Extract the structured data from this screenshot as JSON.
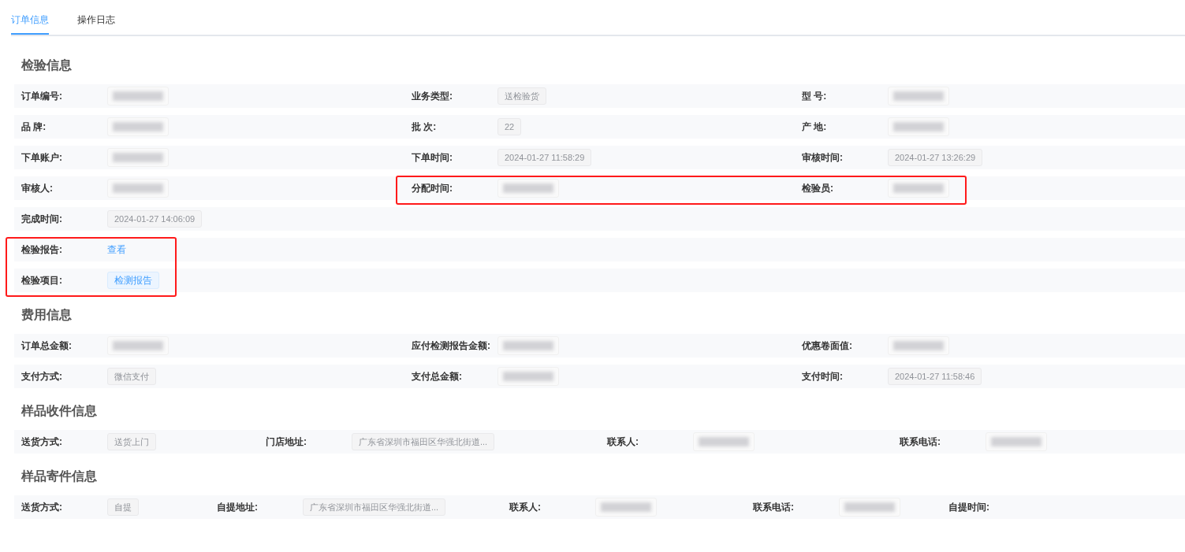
{
  "tabs": [
    {
      "label": "订单信息",
      "selected": true
    },
    {
      "label": "操作日志",
      "selected": false
    }
  ],
  "sections": [
    {
      "title": "检验信息",
      "rows": [
        {
          "fields": [
            {
              "label": "订单编号:",
              "kind": "blurred",
              "highlighted": false
            },
            {
              "label": "业务类型:",
              "kind": "tag",
              "value": "送检验货",
              "highlighted": false
            },
            {
              "label": "型 号:",
              "kind": "blurred",
              "highlighted": false
            }
          ]
        },
        {
          "fields": [
            {
              "label": "品 牌:",
              "kind": "blurred",
              "highlighted": false
            },
            {
              "label": "批 次:",
              "kind": "tag",
              "value": "22",
              "highlighted": false
            },
            {
              "label": "产 地:",
              "kind": "blurred",
              "highlighted": false
            }
          ]
        },
        {
          "fields": [
            {
              "label": "下单账户:",
              "kind": "blurred",
              "highlighted": false
            },
            {
              "label": "下单时间:",
              "kind": "tag",
              "value": "2024-01-27 11:58:29",
              "highlighted": false
            },
            {
              "label": "审核时间:",
              "kind": "tag",
              "value": "2024-01-27 13:26:29",
              "highlighted": false
            }
          ]
        },
        {
          "fields": [
            {
              "label": "审核人:",
              "kind": "blurred",
              "highlighted": false
            },
            {
              "label": "分配时间:",
              "kind": "blurred",
              "highlighted": true
            },
            {
              "label": "检验员:",
              "kind": "blurred",
              "highlighted": true
            }
          ]
        },
        {
          "fields": [
            {
              "label": "完成时间:",
              "kind": "tag",
              "value": "2024-01-27 14:06:09",
              "highlighted": false
            }
          ]
        },
        {
          "fields": [
            {
              "label": "检验报告:",
              "kind": "link",
              "value": "查看",
              "highlighted": true
            }
          ]
        },
        {
          "fields": [
            {
              "label": "检验项目:",
              "kind": "accent",
              "value": "检测报告",
              "highlighted": true
            }
          ]
        }
      ]
    },
    {
      "title": "费用信息",
      "rows": [
        {
          "fields": [
            {
              "label": "订单总金额:",
              "kind": "blurred",
              "highlighted": false
            },
            {
              "label": "应付检测报告金额:",
              "kind": "blurred",
              "highlighted": false
            },
            {
              "label": "优惠卷面值:",
              "kind": "blurred",
              "highlighted": false
            }
          ]
        },
        {
          "fields": [
            {
              "label": "支付方式:",
              "kind": "tag",
              "value": "微信支付",
              "highlighted": false
            },
            {
              "label": "支付总金额:",
              "kind": "blurred",
              "highlighted": false
            },
            {
              "label": "支付时间:",
              "kind": "tag",
              "value": "2024-01-27 11:58:46",
              "highlighted": false
            }
          ]
        }
      ]
    },
    {
      "title": "样品收件信息",
      "rows": [
        {
          "fields": [
            {
              "label": "送货方式:",
              "kind": "tag",
              "value": "送货上门",
              "highlighted": false
            },
            {
              "label": "门店地址:",
              "kind": "tag",
              "value": "广东省深圳市福田区华强北街道...",
              "highlighted": false
            },
            {
              "label": "联系人:",
              "kind": "blurred",
              "highlighted": false
            },
            {
              "label": "联系电话:",
              "kind": "blurred",
              "highlighted": false
            }
          ]
        }
      ]
    },
    {
      "title": "样品寄件信息",
      "rows": [
        {
          "fields": [
            {
              "label": "送货方式:",
              "kind": "tag",
              "value": "自提",
              "highlighted": false
            },
            {
              "label": "自提地址:",
              "kind": "tag",
              "value": "广东省深圳市福田区华强北街道...",
              "highlighted": false
            },
            {
              "label": "联系人:",
              "kind": "blurred",
              "highlighted": false
            },
            {
              "label": "联系电话:",
              "kind": "blurred",
              "highlighted": false
            },
            {
              "label": "自提时间:",
              "kind": "empty",
              "highlighted": false
            }
          ]
        }
      ]
    }
  ]
}
